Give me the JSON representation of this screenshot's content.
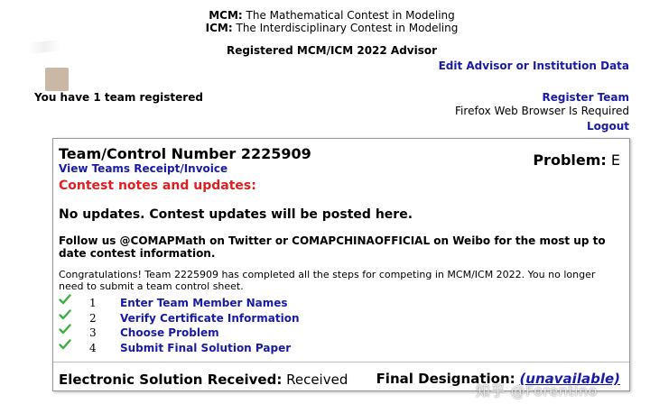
{
  "header": {
    "line1_abbr": "MCM:",
    "line1_text": "The Mathematical Contest in Modeling",
    "line2_abbr": "ICM:",
    "line2_text": "The Interdisciplinary Contest in Modeling",
    "advisor_title": "Registered MCM/ICM 2022 Advisor"
  },
  "top_links": {
    "edit": "Edit Advisor or Institution Data",
    "register": "Register Team",
    "firefox_note": "Firefox Web Browser Is Required",
    "logout": "Logout"
  },
  "team_count_text": "You have 1 team registered",
  "team": {
    "number_label": "Team/Control Number 2225909",
    "receipt_link": "View Teams Receipt/Invoice",
    "problem_label": "Problem:",
    "problem_value": "E",
    "notes_heading": "Contest notes and updates:",
    "updates_text": "No updates. Contest updates will be posted here.",
    "follow_text": "Follow us @COMAPMath on Twitter or COMAPCHINAOFFICIAL on Weibo for the most up to date contest information.",
    "congrats_text": "Congratulations! Team 2225909 has completed all the steps for competing in MCM/ICM 2022. You no longer need to submit a team control sheet.",
    "steps": [
      {
        "num": "1",
        "label": "Enter Team Member Names",
        "icon": "checkmark-icon"
      },
      {
        "num": "2",
        "label": "Verify Certificate Information",
        "icon": "checkmark-icon"
      },
      {
        "num": "3",
        "label": "Choose Problem",
        "icon": "checkmark-icon"
      },
      {
        "num": "4",
        "label": "Submit Final Solution Paper",
        "icon": "checkmark-icon"
      }
    ],
    "solution_label": "Electronic Solution Received:",
    "solution_value": "Received",
    "designation_label": "Final Designation:",
    "designation_value": "(unavailable)"
  },
  "watermark": "知乎 @Forentino",
  "colors": {
    "link": "#1a1aa6",
    "alert": "#e02020",
    "check": "#3cb043"
  }
}
